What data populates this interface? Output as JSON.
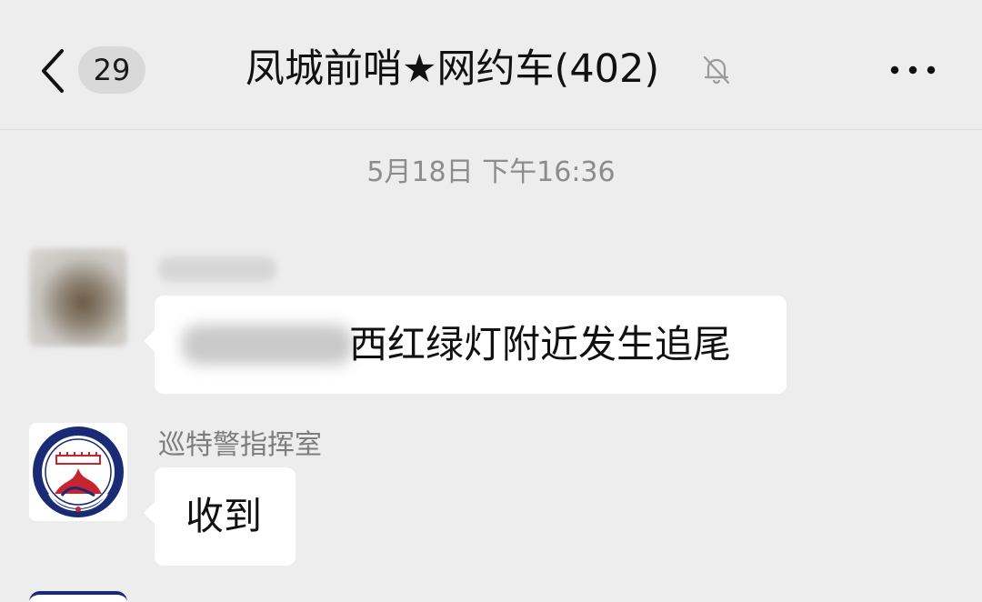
{
  "header": {
    "back_icon": "chevron-left-icon",
    "unread_count": "29",
    "title": "凤城前哨★网约车(402)",
    "mute_icon": "bell-slash-icon",
    "more_icon": "more-dots-icon"
  },
  "chat": {
    "timestamp": "5月18日 下午16:36",
    "messages": [
      {
        "sender": "",
        "text": "西红绿灯附近发生追尾",
        "avatar": "blurred-avatar"
      },
      {
        "sender": "巡特警指挥室",
        "text": "收到",
        "avatar": "police-emblem-avatar"
      }
    ]
  },
  "colors": {
    "background": "#ededed",
    "bubble": "#ffffff",
    "emblem_blue": "#1b2a74",
    "emblem_red": "#c8242f"
  }
}
